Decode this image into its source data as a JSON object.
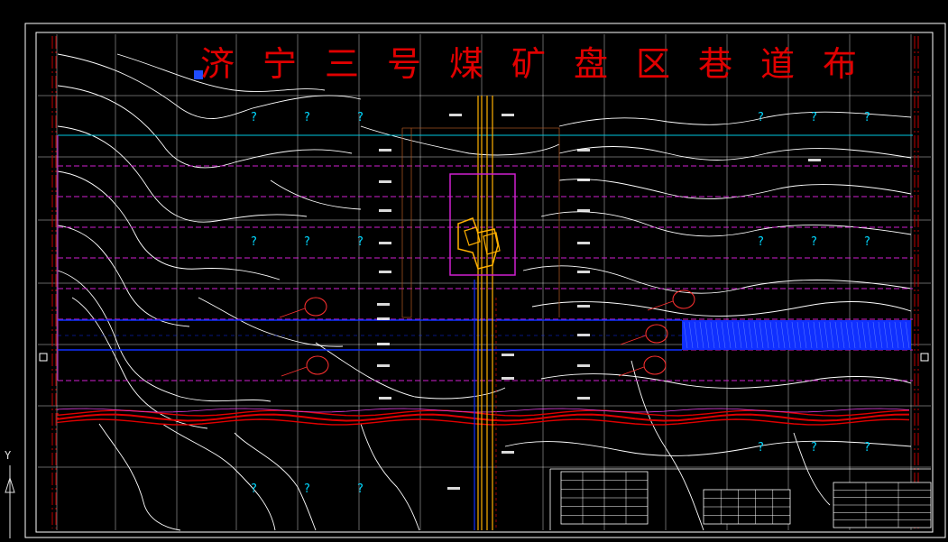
{
  "drawing": {
    "title": "济宁三号煤矿盘区巷道布",
    "axis_label": "Y",
    "unknown_marker": "?"
  },
  "colors": {
    "background": "#000000",
    "frame": "#ffffff",
    "title": "#e00000",
    "contour": "#ffffff",
    "grid": "#ffffff",
    "panel_boundary": "#d020d0",
    "cyan_line": "#00c8e0",
    "roadway_blue": "#1030ff",
    "shaft": "#ffb000",
    "fault_red": "#e00000",
    "label_cyan": "#00d8ff"
  }
}
